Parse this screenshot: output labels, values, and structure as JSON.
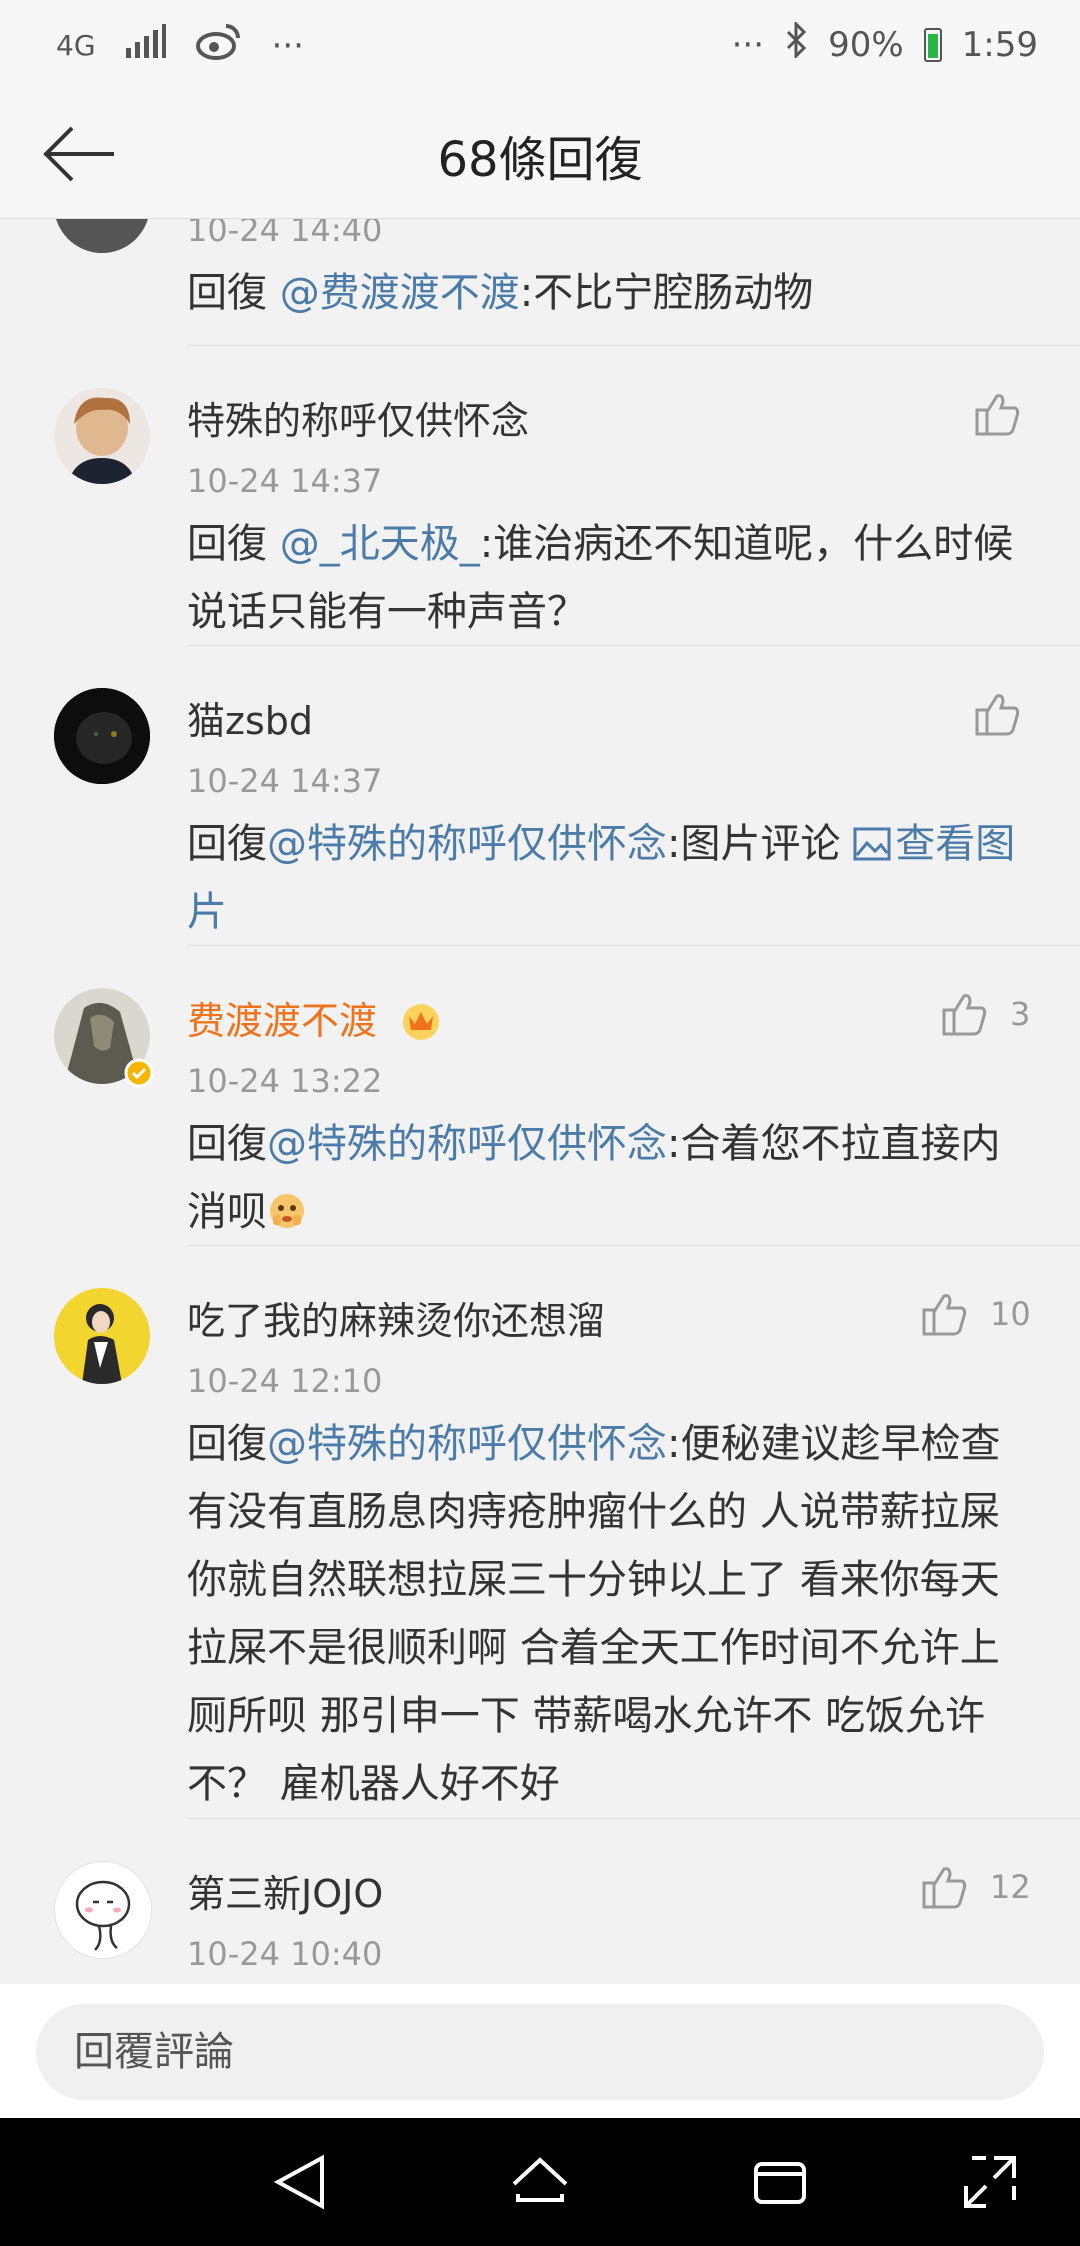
{
  "status_bar": {
    "network": "4G",
    "signal_icon": "signal-icon",
    "weibo_icon": "weibo-icon",
    "left_dots": "···",
    "right_dots": "···",
    "bluetooth_icon": "bluetooth-icon",
    "battery": "90%",
    "time": "1:59"
  },
  "header": {
    "back_icon": "arrow-left-icon",
    "title": "68條回復"
  },
  "comments": [
    {
      "name": "",
      "time": "10-24 14:40",
      "reply_prefix": "回復 ",
      "mention": "@费渡渡不渡",
      "text": ":不比宁腔肠动物",
      "likes": ""
    },
    {
      "name": "特殊的称呼仅供怀念",
      "time": "10-24 14:37",
      "reply_prefix": "回復 ",
      "mention": "@_北天极_",
      "text": ":谁治病还不知道呢，什么时候说话只能有一种声音？",
      "likes": ""
    },
    {
      "name": "猫zsbd",
      "time": "10-24 14:37",
      "reply_prefix": "回復",
      "mention": "@特殊的称呼仅供怀念",
      "text": ":图片评论 ",
      "link": "查看图片",
      "likes": ""
    },
    {
      "name": "费渡渡不渡",
      "time": "10-24 13:22",
      "reply_prefix": "回復",
      "mention": "@特殊的称呼仅供怀念",
      "text": ":合着您不拉直接内消呗",
      "likes": "3"
    },
    {
      "name": "吃了我的麻辣烫你还想溜",
      "time": "10-24 12:10",
      "reply_prefix": "回復",
      "mention": "@特殊的称呼仅供怀念",
      "text": ":便秘建议趁早检查有没有直肠息肉痔疮肿瘤什么的  人说带薪拉屎你就自然联想拉屎三十分钟以上了  看来你每天拉屎不是很顺利啊  合着全天工作时间不允许上厕所呗  那引申一下  带薪喝水允许不  吃饭允许不？  雇机器人好不好",
      "likes": "10"
    },
    {
      "name": "第三新JOJO",
      "time": "10-24 10:40",
      "likes": "12"
    }
  ],
  "reply_bar": {
    "placeholder": "回覆評論"
  },
  "nav_bar": {
    "back_icon": "nav-back-icon",
    "home_icon": "nav-home-icon",
    "recents_icon": "nav-recents-icon",
    "expand_icon": "nav-expand-icon"
  },
  "colors": {
    "mention": "#4b7ba9",
    "vip_name": "#f0731b",
    "background": "#f2f2f2"
  }
}
